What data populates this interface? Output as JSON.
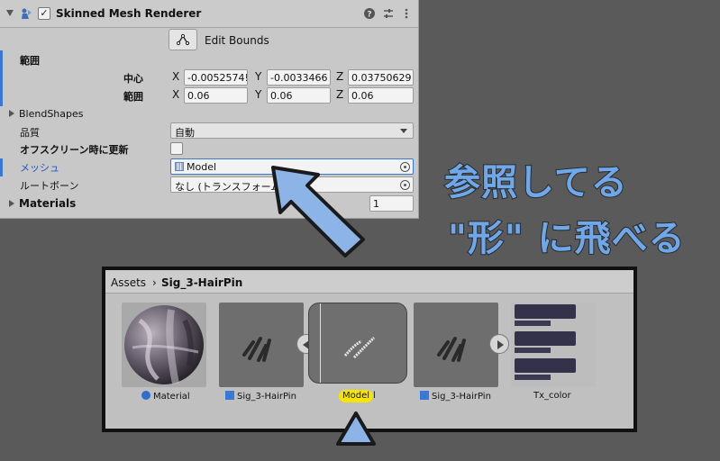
{
  "inspector": {
    "component_title": "Skinned Mesh Renderer",
    "edit_bounds_label": "Edit Bounds",
    "bounds_label": "範囲",
    "center_label": "中心",
    "extent_label": "範囲",
    "axis_x": "X",
    "axis_y": "Y",
    "axis_z": "Z",
    "center": {
      "x": "-0.0052574!",
      "y": "-0.0033466",
      "z": "0.03750629"
    },
    "extent": {
      "x": "0.06",
      "y": "0.06",
      "z": "0.06"
    },
    "blendshapes_label": "BlendShapes",
    "quality_label": "品質",
    "quality_value": "自動",
    "offscreen_label": "オフスクリーン時に更新",
    "mesh_label": "メッシュ",
    "mesh_value": "Model",
    "root_bone_label": "ルートボーン",
    "root_bone_value": "なし (トランスフォーム)",
    "materials_label": "Materials",
    "materials_count": "1"
  },
  "callout": {
    "line1": "参照してる",
    "line2": "\"形\" に飛べる"
  },
  "project": {
    "breadcrumb_root": "Assets",
    "breadcrumb_separator": "›",
    "breadcrumb_folder": "Sig_3-HairPin",
    "assets": [
      {
        "name": "Material"
      },
      {
        "name": "Sig_3-HairPin"
      },
      {
        "name_highlight": "Model",
        "name_rest": "l"
      },
      {
        "name": "Sig_3-HairPin"
      },
      {
        "name": "Tx_color"
      }
    ]
  },
  "colors": {
    "accent_blue": "#3a78d6",
    "callout_text": "#6fa8ea",
    "highlight_yellow": "#f6e500",
    "arrow_fill": "#8cb4e6"
  }
}
